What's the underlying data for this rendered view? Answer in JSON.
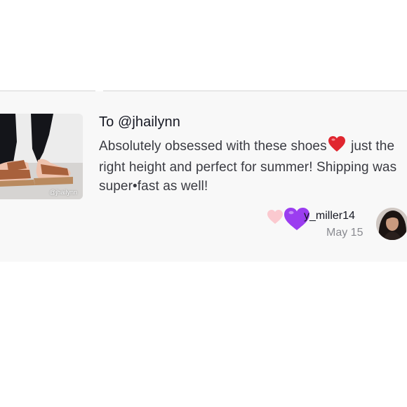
{
  "post": {
    "recipient": "To @jhailynn",
    "message_part1": "Absolutely obsessed with these shoes",
    "message_part2": " just the right height and perfect for summer! Shipping was super",
    "message_dot": "•",
    "message_part3": "fast as well!",
    "inline_icon": "red-heart-icon",
    "thumbnail_handle": "@jhailynn"
  },
  "reply": {
    "username": "y_miller14",
    "date": "May 15",
    "like_icon": "pink-heart-icon",
    "badge_icon": "purple-heart-icon"
  },
  "colors": {
    "background": "#ffffff",
    "card_background": "#f8f8f8",
    "divider": "#d6d6d6",
    "primary_text": "#161823",
    "secondary_text": "#8a8b91",
    "red_heart": "#e0262f",
    "purple_heart": "#9b3df0",
    "pink_heart": "#fbc9cf"
  }
}
